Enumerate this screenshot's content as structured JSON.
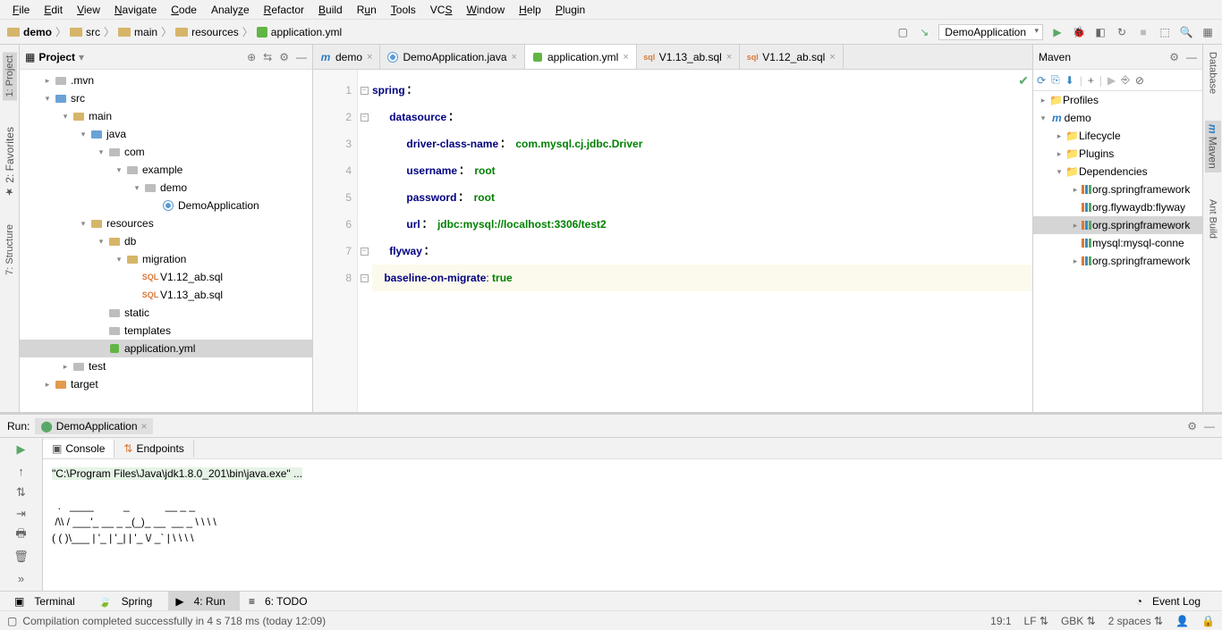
{
  "menu": [
    "File",
    "Edit",
    "View",
    "Navigate",
    "Code",
    "Analyze",
    "Refactor",
    "Build",
    "Run",
    "Tools",
    "VCS",
    "Window",
    "Help",
    "Plugin"
  ],
  "breadcrumb": [
    "demo",
    "src",
    "main",
    "resources",
    "application.yml"
  ],
  "runConfig": "DemoApplication",
  "projectPanel": {
    "title": "Project"
  },
  "tree": {
    "mvn": ".mvn",
    "src": "src",
    "main": "main",
    "java": "java",
    "com": "com",
    "example": "example",
    "demo": "demo",
    "demoApp": "DemoApplication",
    "resources": "resources",
    "db": "db",
    "migration": "migration",
    "v112": "V1.12_ab.sql",
    "v113": "V1.13_ab.sql",
    "static": "static",
    "templates": "templates",
    "appyml": "application.yml",
    "test": "test",
    "target": "target"
  },
  "tabs": [
    {
      "label": "demo",
      "icon": "m",
      "active": false
    },
    {
      "label": "DemoApplication.java",
      "icon": "java",
      "active": false
    },
    {
      "label": "application.yml",
      "icon": "yml",
      "active": true
    },
    {
      "label": "V1.13_ab.sql",
      "icon": "sql",
      "active": false
    },
    {
      "label": "V1.12_ab.sql",
      "icon": "sql",
      "active": false
    }
  ],
  "editor": {
    "lines": [
      "1",
      "2",
      "3",
      "4",
      "5",
      "6",
      "7",
      "8"
    ],
    "k_spring": "spring",
    "k_datasource": "datasource",
    "k_driver": "driver-class-name",
    "v_driver": "com.mysql.cj.jdbc.Driver",
    "k_user": "username",
    "v_user": "root",
    "k_pass": "password",
    "v_pass": "root",
    "k_url": "url",
    "v_url": "jdbc:mysql://localhost:3306/test2",
    "k_flyway": "flyway",
    "k_baseline": "baseline-on-migrate",
    "v_true": "true"
  },
  "maven": {
    "title": "Maven",
    "profiles": "Profiles",
    "demo": "demo",
    "lifecycle": "Lifecycle",
    "plugins": "Plugins",
    "deps": "Dependencies",
    "d1": "org.springframework",
    "d2": "org.flywaydb:flyway",
    "d3": "org.springframework",
    "d4": "mysql:mysql-conne",
    "d5": "org.springframework"
  },
  "run": {
    "label": "Run:",
    "tab": "DemoApplication",
    "console": "Console",
    "endpoints": "Endpoints",
    "cmd": "\"C:\\Program Files\\Java\\jdk1.8.0_201\\bin\\java.exe\" ...",
    "ascii1": "  .   ____          _            __ _ _",
    "ascii2": " /\\\\ / ___'_ __ _ _(_)_ __  __ _ \\ \\ \\ \\",
    "ascii3": "( ( )\\___ | '_ | '_| | '_ \\/ _` | \\ \\ \\ \\"
  },
  "bottomTools": {
    "terminal": "Terminal",
    "spring": "Spring",
    "run4": "4: Run",
    "todo": "6: TODO",
    "eventlog": "Event Log"
  },
  "status": {
    "msg": "Compilation completed successfully in 4 s 718 ms (today 12:09)",
    "pos": "19:1",
    "enc": "LF",
    "charset": "GBK",
    "indent": "2 spaces"
  },
  "leftGutter": [
    "1: Project",
    "2: Favorites",
    "7: Structure"
  ],
  "rightGutter": [
    "Database",
    "Maven",
    "Ant Build"
  ]
}
